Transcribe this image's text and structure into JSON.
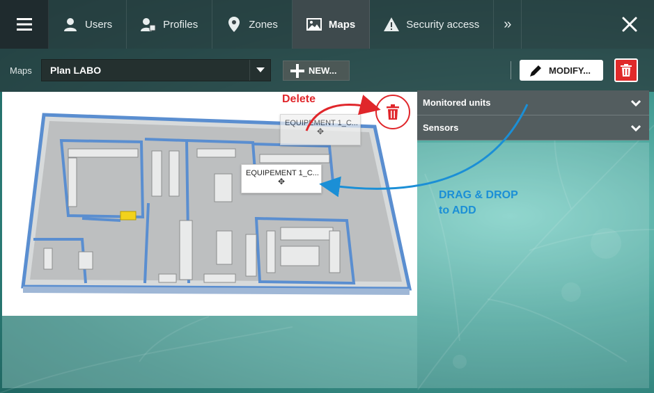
{
  "nav": {
    "menu_icon": "hamburger-icon",
    "tabs": [
      {
        "label": "Users",
        "icon": "user-icon",
        "active": false
      },
      {
        "label": "Profiles",
        "icon": "profiles-icon",
        "active": false
      },
      {
        "label": "Zones",
        "icon": "map-pin-icon",
        "active": false
      },
      {
        "label": "Maps",
        "icon": "image-icon",
        "active": true
      },
      {
        "label": "Security access",
        "icon": "warning-icon",
        "active": false
      }
    ],
    "more_icon": "double-chevron-right-icon",
    "close_icon": "close-icon"
  },
  "toolbar": {
    "maps_label": "Maps",
    "selected_map": "Plan LABO",
    "new_label": "NEW...",
    "modify_label": "MODIFY..."
  },
  "map": {
    "equipment_ghost": "EQUIPEMENT 1_C...",
    "equipment_dragged": "EQUIPEMENT 1_C...",
    "delete_annotation": "Delete"
  },
  "right_panel": {
    "sections": [
      {
        "label": "Monitored units",
        "expanded": false
      },
      {
        "label": "Sensors",
        "expanded": false
      }
    ],
    "annotation_line1": "DRAG & DROP",
    "annotation_line2": "to ADD"
  },
  "colors": {
    "accent_red": "#e02a2a",
    "annotation_blue": "#1b8fd6",
    "nav_dark": "#1f2b2e"
  }
}
